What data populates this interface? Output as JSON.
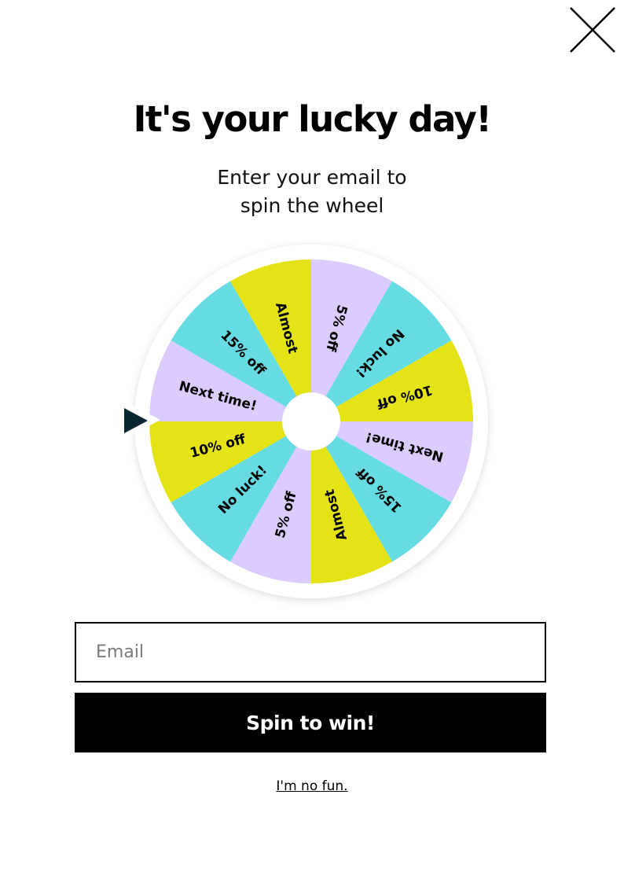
{
  "close": {
    "icon": "close-icon"
  },
  "title": "It's your lucky day!",
  "subtitle": "Enter your email to spin the wheel",
  "wheel": {
    "segments": [
      {
        "label": "5% off",
        "color": "#dccbfd"
      },
      {
        "label": "No luck!",
        "color": "#66dce2"
      },
      {
        "label": "10% off",
        "color": "#e3e316"
      },
      {
        "label": "Next time!",
        "color": "#dccbfd"
      },
      {
        "label": "15% off",
        "color": "#66dce2"
      },
      {
        "label": "Almost",
        "color": "#e3e316"
      },
      {
        "label": "5% off",
        "color": "#dccbfd"
      },
      {
        "label": "No luck!",
        "color": "#66dce2"
      },
      {
        "label": "10% off",
        "color": "#e3e316"
      },
      {
        "label": "Next time!",
        "color": "#dccbfd"
      },
      {
        "label": "15% off",
        "color": "#66dce2"
      },
      {
        "label": "Almost",
        "color": "#e3e316"
      }
    ],
    "pointer_icon": "play-triangle-icon",
    "pointer_color": "#0b2533"
  },
  "form": {
    "email_placeholder": "Email",
    "email_value": "",
    "submit_label": "Spin to win!",
    "decline_label": "I'm no fun."
  }
}
